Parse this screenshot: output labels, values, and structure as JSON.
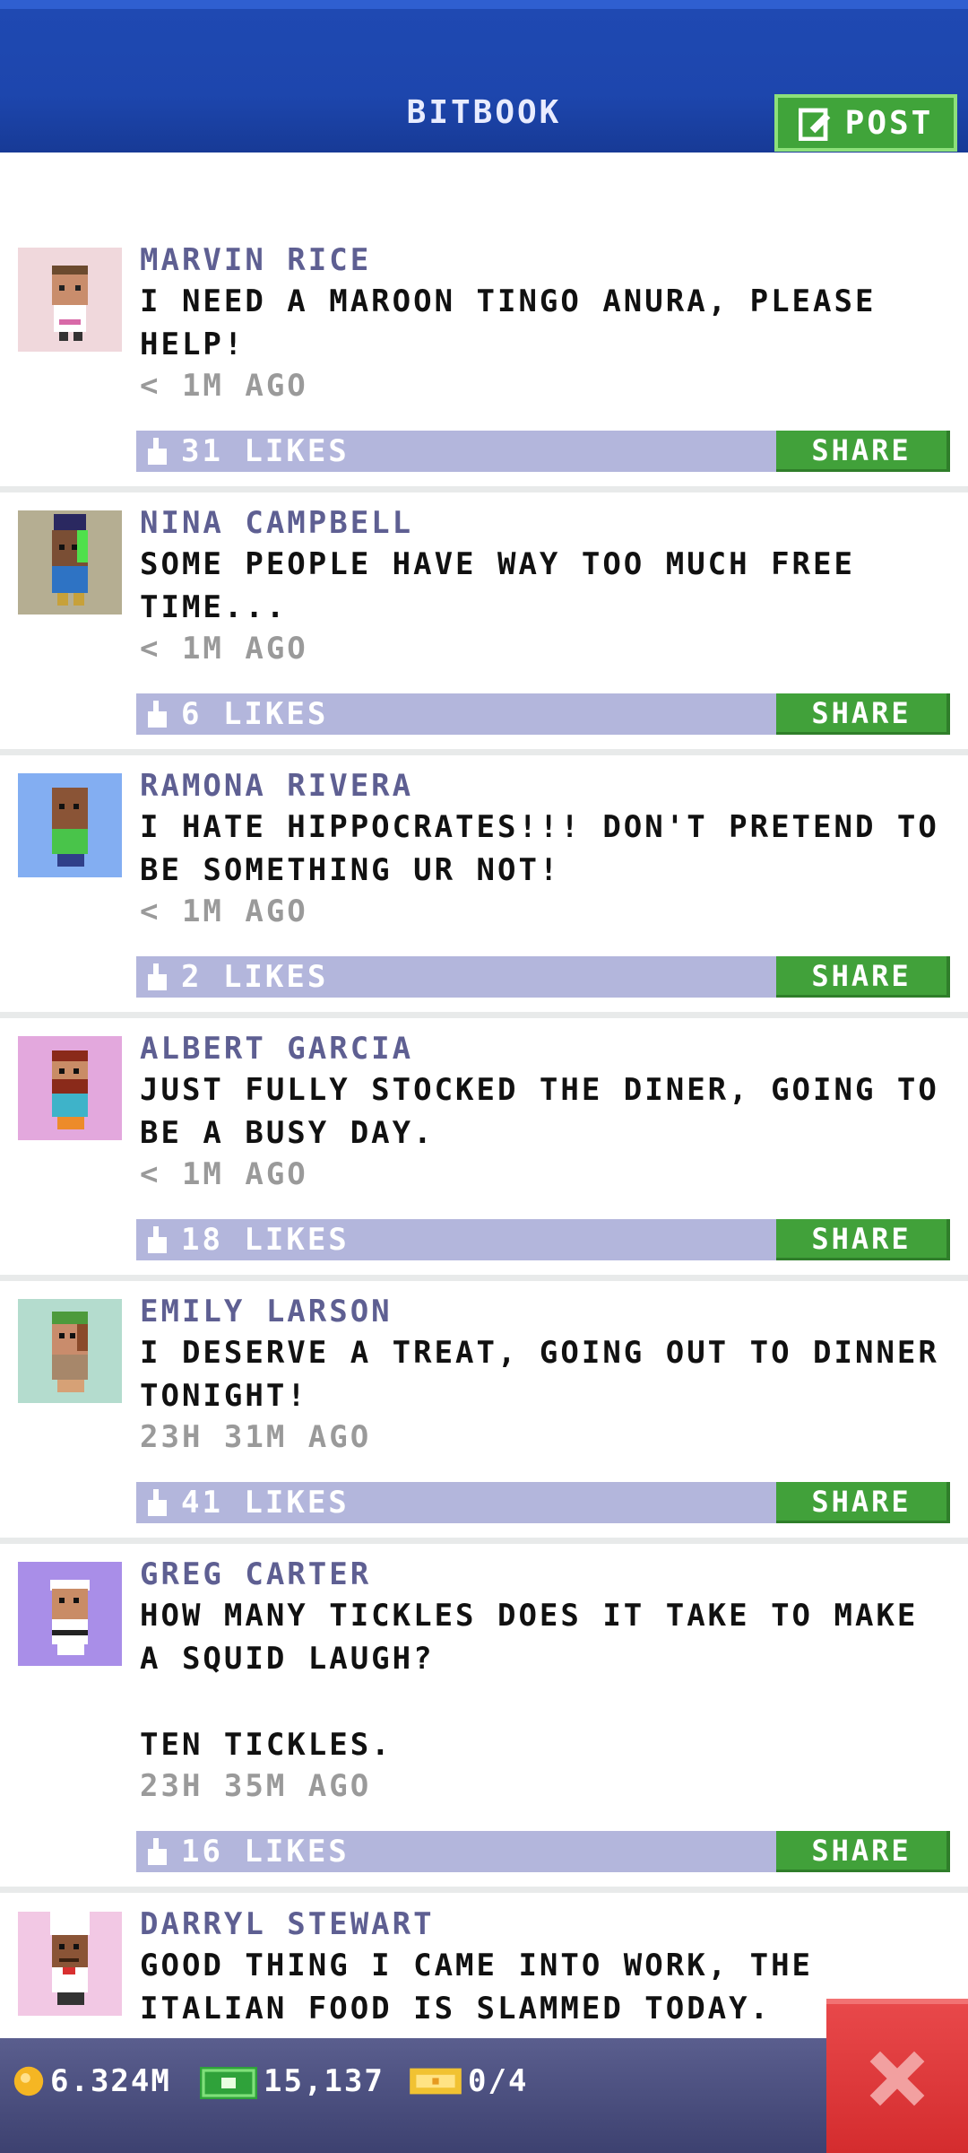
{
  "header": {
    "title": "BITBOOK",
    "post_label": "POST"
  },
  "posts": [
    {
      "author": "MARVIN RICE",
      "text": "I NEED A MAROON TINGO ANURA, PLEASE HELP!",
      "time": "< 1M AGO",
      "likes": "31 LIKES",
      "share": "SHARE",
      "avatar_bg": "#f0d8dc"
    },
    {
      "author": "NINA CAMPBELL",
      "text": "SOME PEOPLE HAVE WAY TOO MUCH FREE TIME...",
      "time": "< 1M AGO",
      "likes": "6 LIKES",
      "share": "SHARE",
      "avatar_bg": "#b5ae92"
    },
    {
      "author": "RAMONA RIVERA",
      "text": "I HATE HIPPOCRATES!!! DON'T PRETEND TO BE SOMETHING UR NOT!",
      "time": "< 1M AGO",
      "likes": "2 LIKES",
      "share": "SHARE",
      "avatar_bg": "#83aef2"
    },
    {
      "author": "ALBERT GARCIA",
      "text": "JUST FULLY STOCKED THE DINER, GOING TO BE A BUSY DAY.",
      "time": "< 1M AGO",
      "likes": "18 LIKES",
      "share": "SHARE",
      "avatar_bg": "#e3a8dd"
    },
    {
      "author": "EMILY LARSON",
      "text": "I DESERVE A TREAT, GOING OUT TO DINNER TONIGHT!",
      "time": "23H 31M AGO",
      "likes": "41 LIKES",
      "share": "SHARE",
      "avatar_bg": "#b4dcce"
    },
    {
      "author": "GREG CARTER",
      "text": "HOW MANY TICKLES DOES IT TAKE TO MAKE A SQUID LAUGH?\n\nTEN TICKLES.",
      "time": "23H 35M AGO",
      "likes": "16 LIKES",
      "share": "SHARE",
      "avatar_bg": "#a98ee8"
    },
    {
      "author": "DARRYL STEWART",
      "text": "GOOD THING I CAME INTO WORK, THE ITALIAN FOOD IS SLAMMED TODAY.",
      "time": "",
      "likes": "",
      "share": "",
      "avatar_bg": "#f2c8e4"
    }
  ],
  "status": {
    "coins": "6.324M",
    "bux": "15,137",
    "tickets": "0/4"
  },
  "colors": {
    "header": "#1d46ad",
    "accent_green": "#41a13a",
    "likes_bar": "#b3b6dc",
    "close_red": "#d42c2e"
  }
}
